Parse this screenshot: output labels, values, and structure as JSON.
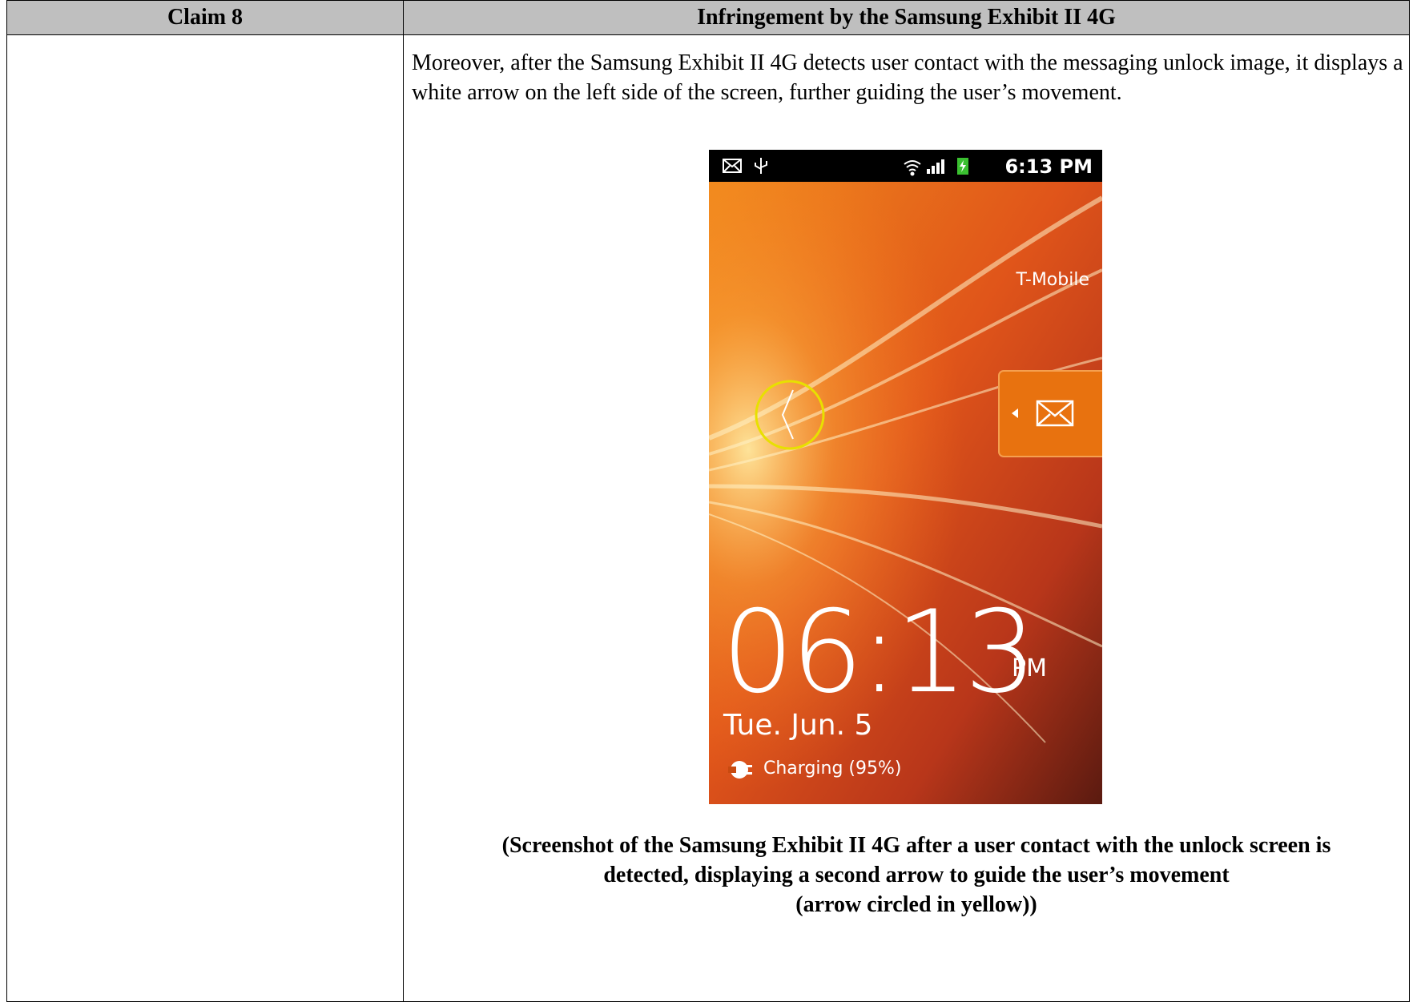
{
  "table": {
    "header_left": "Claim 8",
    "header_right": "Infringement by the Samsung Exhibit II 4G"
  },
  "body_paragraph": "Moreover, after the Samsung Exhibit II 4G detects user contact with the messaging unlock image, it displays a white arrow on the left side of the screen, further guiding the user’s movement.",
  "phone": {
    "status_time": "6:13 PM",
    "carrier": "T-Mobile",
    "clock": "06:13",
    "ampm": "PM",
    "date": "Tue. Jun. 5",
    "charging": "Charging (95%)",
    "icons": [
      "mail-icon",
      "usb-icon",
      "wifi-icon",
      "signal-icon",
      "battery-charging-icon",
      "left-arrow-icon",
      "envelope-unlock-icon",
      "charging-plug-icon"
    ],
    "highlight_color": "#e8e000",
    "accent_color": "#e86a10"
  },
  "caption": {
    "line1": "(Screenshot of the Samsung Exhibit II 4G after a user contact with the unlock screen is",
    "line2": "detected, displaying a second arrow to guide the user’s movement",
    "line3": "(arrow circled in yellow))"
  }
}
